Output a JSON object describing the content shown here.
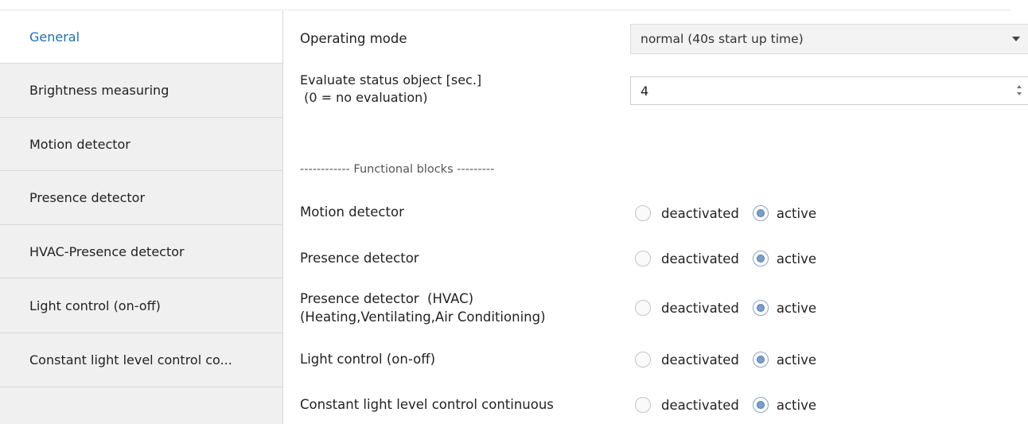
{
  "sidebar": {
    "items": [
      {
        "label": "General",
        "selected": true
      },
      {
        "label": "Brightness measuring",
        "selected": false
      },
      {
        "label": "Motion detector",
        "selected": false
      },
      {
        "label": "Presence detector",
        "selected": false
      },
      {
        "label": "HVAC-Presence detector",
        "selected": false
      },
      {
        "label": "Light control (on-off)",
        "selected": false
      },
      {
        "label": "Constant light level control co...",
        "selected": false
      }
    ]
  },
  "general": {
    "operating_mode": {
      "label": "Operating mode",
      "value": "normal (40s start up time)"
    },
    "evaluate_status": {
      "label_line1": "Evaluate status object [sec.]",
      "label_line2": " (0 = no evaluation)",
      "value": "4"
    },
    "section_title": "------------ Functional blocks ---------",
    "option_labels": {
      "off": "deactivated",
      "on": "active"
    },
    "blocks": [
      {
        "label": "Motion detector",
        "selected": "active"
      },
      {
        "label": "Presence detector",
        "selected": "active"
      },
      {
        "label_line1": "Presence detector  (HVAC)",
        "label_line2": "(Heating,Ventilating,Air Conditioning)",
        "selected": "active"
      },
      {
        "label": "Light control (on-off)",
        "selected": "active"
      },
      {
        "label": "Constant light level control continuous",
        "selected": "active"
      }
    ]
  },
  "colors": {
    "selected_tab_text": "#1c6fb4",
    "sidebar_background": "#f0f0f0",
    "radio_checked": "#7b9dc8"
  }
}
